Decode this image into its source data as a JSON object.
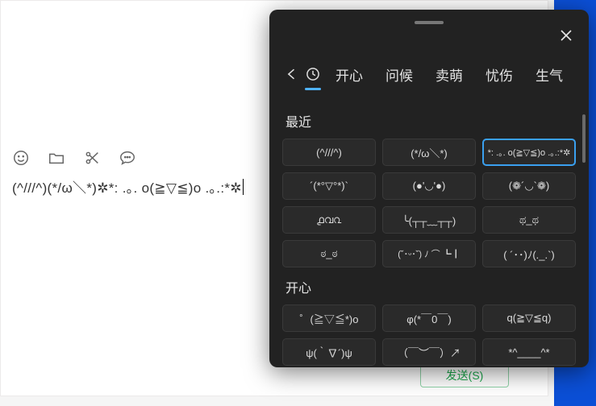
{
  "compose": {
    "text": "(^///^)(*/ω＼*)✲*: .｡. o(≧▽≦)o .｡.:*✲",
    "send_label": "发送(S)"
  },
  "panel": {
    "tabs": {
      "happy": "开心",
      "greet": "问候",
      "cute": "卖萌",
      "sad": "忧伤",
      "angry": "生气"
    },
    "sections": {
      "recent_title": "最近",
      "happy_title": "开心"
    },
    "recent": [
      "(^///^)",
      "(*/ω＼*)",
      "*: .｡. o(≧▽≦)o .｡.:*✲",
      "´(*°▽°*)`",
      "(●'◡'●)",
      "(❁´◡`❁)",
      "൧വ൨",
      "╰(┬┬﹏┬┬)",
      "ಥ_ಥ",
      "ಠ_ಠ",
      "(˘･ᵕ･˘) ﾉ ⌒ ┗┃",
      "( ´･･)ﾉ(._.`)"
    ],
    "happy": [
      "゜(≧▽≦*)o",
      "φ(*￣0￣)",
      "q(≧▽≦q)",
      "ψ(｀∇´)ψ",
      "（￣︶￣）↗",
      "*^____^*"
    ]
  }
}
